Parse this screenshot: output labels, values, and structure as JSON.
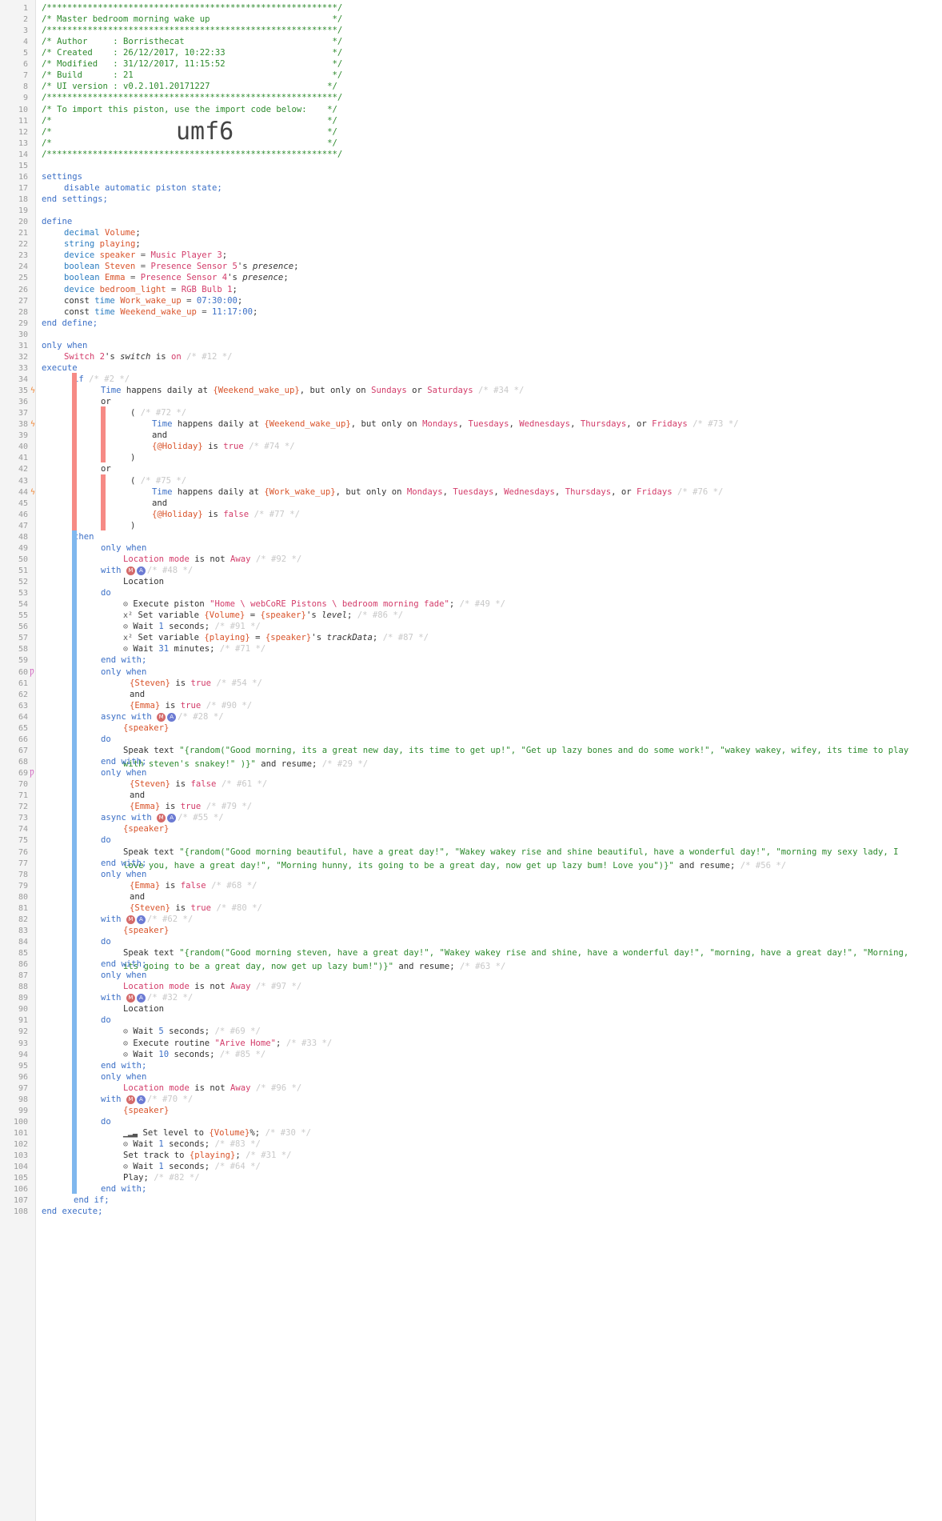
{
  "header": {
    "stars": "/*********************************************************/",
    "title": "/* Master bedroom morning wake up                        */",
    "author": "/* Author     : Borristhecat                             */",
    "created": "/* Created    : 26/12/2017, 10:22:33                     */",
    "modified": "/* Modified   : 31/12/2017, 11:15:52                     */",
    "build": "/* Build      : 21                                       */",
    "ui_version": "/* UI version : v0.2.101.20171227                       */",
    "import_note": "/* To import this piston, use the import code below:    */",
    "blank": "/*                                                      */",
    "blank_prefix": "/*",
    "blank_suffix": "*/",
    "import_code": "umf6"
  },
  "settings": {
    "open": "settings",
    "item": "disable automatic piston state;",
    "close": "end settings;"
  },
  "define": {
    "open": "define",
    "close": "end define;",
    "vars": [
      {
        "type": "decimal",
        "name": "Volume",
        "tail": ";"
      },
      {
        "type": "string",
        "name": "playing",
        "tail": ";"
      },
      {
        "type": "device",
        "name": "speaker",
        "op": " = ",
        "device": "Music Player 3",
        "tail": ";"
      },
      {
        "type": "boolean",
        "name": "Steven",
        "op": " = ",
        "device": "Presence Sensor 5",
        "attr": "presence",
        "tail": ";"
      },
      {
        "type": "boolean",
        "name": "Emma",
        "op": " = ",
        "device": "Presence Sensor 4",
        "attr": "presence",
        "tail": ";"
      },
      {
        "type": "device",
        "name": "bedroom_light",
        "op": " = ",
        "device": "RGB Bulb 1",
        "tail": ";"
      },
      {
        "kw": "const",
        "type": "time",
        "name": "Work_wake_up",
        "op": " = ",
        "value": "07:30:00",
        "tail": ";"
      },
      {
        "kw": "const",
        "type": "time",
        "name": "Weekend_wake_up",
        "op": " = ",
        "value": "11:17:00",
        "tail": ";"
      }
    ]
  },
  "kw": {
    "only_when": "only when",
    "execute": "execute",
    "end_execute": "end execute;",
    "if": "if",
    "or": "or",
    "and": "and",
    "then": "then",
    "with": "with",
    "async_with": "async with",
    "do": "do",
    "end_with": "end with;",
    "end_if": "end if;",
    "open_paren": "(",
    "close_paren": ")",
    "is": " is ",
    "is_not": " is not ",
    "s_switch": "'s ",
    "switch_attr": "switch",
    "true": "true",
    "false": "false",
    "on": "on",
    "away": "Away",
    "location_mode": "Location mode",
    "location": "Location",
    "time_happens": "Time",
    "happens_daily": " happens daily at ",
    "but_only_on": ", but only on ",
    "or_word": " or ",
    "comma": ", ",
    "or_comma": ", or ",
    "execute_piston": "Execute piston ",
    "execute_routine": "Execute routine ",
    "set_variable": "Set variable ",
    "set_level": "Set level to ",
    "set_track": "Set track to ",
    "speak_text": "Speak text ",
    "wait": "Wait ",
    "seconds": " seconds;",
    "minutes": " minutes;",
    "play": "Play;",
    "and_resume": " and resume;",
    "level_attr": "level",
    "trackdata_attr": "trackData",
    "semicolon": ";",
    "percent_semicolon": "%;",
    "eq": " = ",
    "apostrophe_s": "'s "
  },
  "devices": {
    "switch2": "Switch 2"
  },
  "days": {
    "sundays": "Sundays",
    "saturdays": "Saturdays",
    "mondays": "Mondays",
    "tuesdays": "Tuesdays",
    "wednesdays": "Wednesdays",
    "thursdays": "Thursdays",
    "fridays": "Fridays"
  },
  "vars_ref": {
    "weekend": "{Weekend_wake_up}",
    "work": "{Work_wake_up}",
    "holiday": "{@Holiday}",
    "steven": "{Steven}",
    "emma": "{Emma}",
    "speaker": "{speaker}",
    "volume": "{Volume}",
    "playing": "{playing}"
  },
  "ids": {
    "c12": "/* #12 */",
    "c2": "/* #2 */",
    "c34": "/* #34 */",
    "c72": "/* #72 */",
    "c73": "/* #73 */",
    "c74": "/* #74 */",
    "c75": "/* #75 */",
    "c76": "/* #76 */",
    "c77": "/* #77 */",
    "c92": "/* #92 */",
    "c48": "/* #48 */",
    "c49": "/* #49 */",
    "c86": "/* #86 */",
    "c91": "/* #91 */",
    "c87": "/* #87 */",
    "c71": "/* #71 */",
    "c54": "/* #54 */",
    "c90": "/* #90 */",
    "c28": "/* #28 */",
    "c29": "/* #29 */",
    "c61": "/* #61 */",
    "c79": "/* #79 */",
    "c55": "/* #55 */",
    "c56": "/* #56 */",
    "c68": "/* #68 */",
    "c80": "/* #80 */",
    "c62": "/* #62 */",
    "c63": "/* #63 */",
    "c97": "/* #97 */",
    "c32": "/* #32 */",
    "c69": "/* #69 */",
    "c33": "/* #33 */",
    "c85": "/* #85 */",
    "c96": "/* #96 */",
    "c70": "/* #70 */",
    "c30": "/* #30 */",
    "c83": "/* #83 */",
    "c31": "/* #31 */",
    "c64": "/* #64 */",
    "c82": "/* #82 */"
  },
  "strings": {
    "piston": "\"Home \\ webCoRE Pistons \\ bedroom morning fade\"",
    "routine": "\"Arive Home\"",
    "speak1": "\"{random(\"Good morning, its a great new day, its time to get up!\", \"Get up lazy bones and do some work!\", \"wakey wakey, wifey, its time to play with steven's snakey!\" )}\"",
    "speak2": "\"{random(\"Good morning beautiful, have a great day!\", \"Wakey wakey rise and shine beautiful, have a wonderful day!\", \"morning my sexy lady, I love you, have a great day!\", \"Morning hunny, its going to be a great day, now get up lazy bum! Love you\")}\"",
    "speak3": "\"{random(\"Good morning steven, have a great day!\", \"Wakey wakey rise and shine, have a wonderful day!\", \"morning, have a great day!\", \"Morning, its going to be a great day, now get up lazy bum!\")}\""
  },
  "numbers": {
    "one": "1",
    "thirtyone": "31",
    "five": "5",
    "ten": "10"
  },
  "badges": {
    "m": "M",
    "a": "A"
  },
  "icons": {
    "clock": "⊙",
    "var": "x²",
    "level": "▁▂▃",
    "bolt": "ϟ",
    "restriction": "Ƿ"
  },
  "line_numbers": [
    "1",
    "2",
    "3",
    "4",
    "5",
    "6",
    "7",
    "8",
    "9",
    "10",
    "11",
    "12",
    "13",
    "14",
    "15",
    "16",
    "17",
    "18",
    "19",
    "20",
    "21",
    "22",
    "23",
    "24",
    "25",
    "26",
    "27",
    "28",
    "29",
    "30",
    "31",
    "32",
    "33",
    "34",
    "35",
    "36",
    "37",
    "38",
    "39",
    "40",
    "41",
    "42",
    "43",
    "44",
    "45",
    "46",
    "47",
    "48",
    "49",
    "50",
    "51",
    "52",
    "53",
    "54",
    "55",
    "56",
    "57",
    "58",
    "59",
    "60",
    "61",
    "62",
    "63",
    "64",
    "65",
    "66",
    "67",
    "68",
    "69",
    "70",
    "71",
    "72",
    "73",
    "74",
    "75",
    "76",
    "77",
    "78",
    "79",
    "80",
    "81",
    "82",
    "83",
    "84",
    "85",
    "86",
    "87",
    "88",
    "89",
    "90",
    "91",
    "92",
    "93",
    "94",
    "95",
    "96",
    "97",
    "98",
    "99",
    "100",
    "101",
    "102",
    "103",
    "104",
    "105",
    "106",
    "107",
    "108"
  ],
  "colors": {
    "comment": "#2d8a2d",
    "keyword": "#3b6fc6",
    "variable": "#d9542b",
    "device": "#d33c6a",
    "if_bar": "#f68a85",
    "then_bar": "#7fb7ee"
  }
}
